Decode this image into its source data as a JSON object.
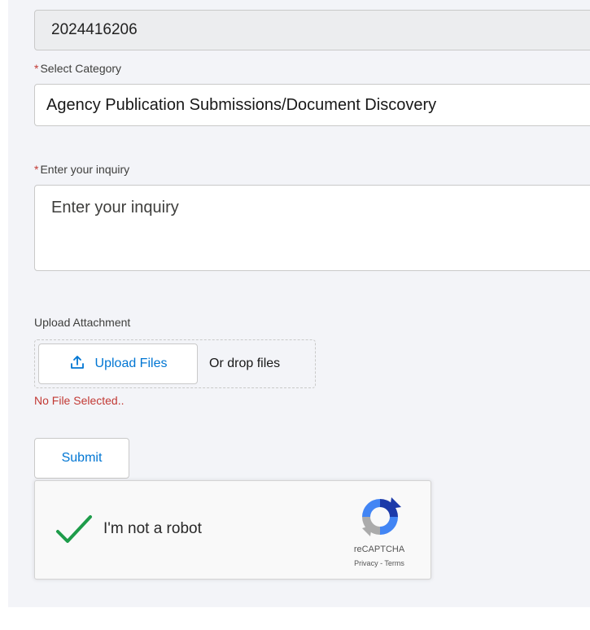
{
  "form": {
    "case_number": "2024416206",
    "required_marker": "*",
    "category_label": "Select Category",
    "category_value": "Agency Publication Submissions/Document Discovery",
    "inquiry_label": "Enter your inquiry",
    "inquiry_placeholder": "Enter your inquiry",
    "upload_label": "Upload Attachment",
    "upload_button": "Upload Files",
    "drop_text": "Or drop files",
    "no_file_text": "No File Selected..",
    "submit_label": "Submit"
  },
  "recaptcha": {
    "label": "I'm not a robot",
    "brand": "reCAPTCHA",
    "privacy": "Privacy",
    "separator": " - ",
    "terms": "Terms",
    "checked": true,
    "check_color": "#1e9c4a"
  },
  "colors": {
    "accent": "#0176d3",
    "error": "#c23934",
    "background": "#f3f4f8"
  },
  "icons": [
    "upload-icon",
    "checkmark-icon",
    "recaptcha-logo-icon"
  ]
}
